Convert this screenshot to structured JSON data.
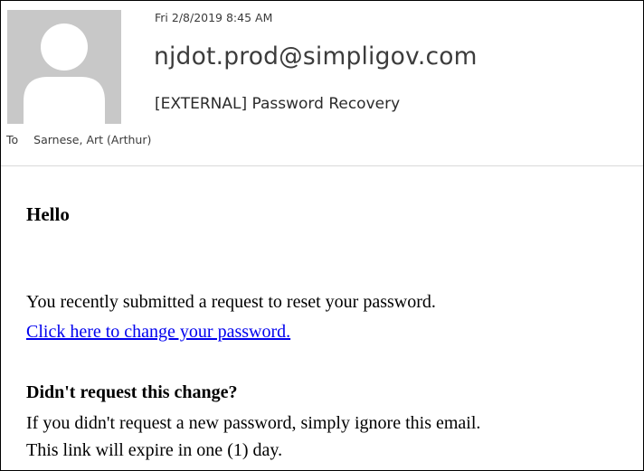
{
  "email": {
    "date": "Fri 2/8/2019 8:45 AM",
    "sender": "njdot.prod@simpligov.com",
    "subject": "[EXTERNAL] Password Recovery",
    "to_label": "To",
    "to_value": "Sarnese, Art (Arthur)"
  },
  "body": {
    "greeting": "Hello",
    "request_text": "You recently submitted a request to reset your password.",
    "link_text": "Click here to change your password.",
    "question": "Didn't request this change?",
    "ignore_text": "If you didn't request a new password, simply ignore this email.",
    "expire_text": "This link will expire in one (1) day."
  },
  "icons": {
    "avatar": "default-person-avatar-icon"
  },
  "colors": {
    "link": "#0000ee",
    "avatar_bg": "#c8c8c8",
    "avatar_figure": "#ffffff",
    "divider": "#d9d9d9"
  }
}
